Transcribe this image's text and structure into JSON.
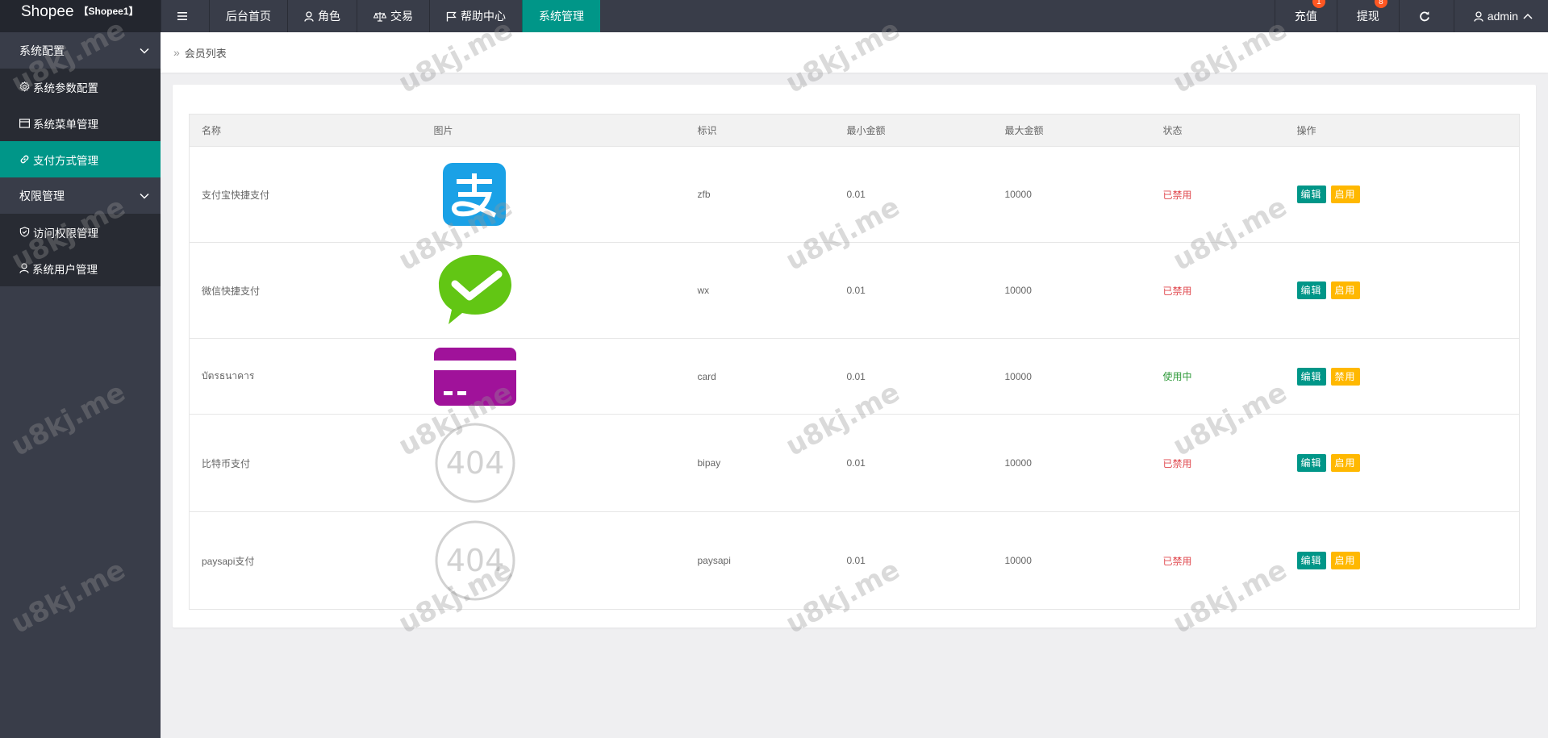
{
  "brand": {
    "name": "Shopee",
    "sub": "【Shopee1】"
  },
  "topnav": {
    "items": [
      {
        "label": "后台首页",
        "icon": "none"
      },
      {
        "label": "角色",
        "icon": "user-icon"
      },
      {
        "label": "交易",
        "icon": "scale-icon"
      },
      {
        "label": "帮助中心",
        "icon": "flag-icon"
      },
      {
        "label": "系统管理",
        "icon": "none",
        "active": true
      }
    ],
    "right": [
      {
        "label": "充值",
        "badge": "1"
      },
      {
        "label": "提现",
        "badge": "8"
      }
    ],
    "admin": "admin"
  },
  "sidebar": {
    "groups": [
      {
        "title": "系统配置",
        "items": [
          {
            "label": "系统参数配置",
            "icon": "gear-icon"
          },
          {
            "label": "系统菜单管理",
            "icon": "menu-icon"
          },
          {
            "label": "支付方式管理",
            "icon": "link-icon",
            "active": true
          }
        ]
      },
      {
        "title": "权限管理",
        "items": [
          {
            "label": "访问权限管理",
            "icon": "shield-icon"
          },
          {
            "label": "系统用户管理",
            "icon": "user-icon"
          }
        ]
      }
    ]
  },
  "breadcrumb": {
    "label": "会员列表"
  },
  "table": {
    "headers": [
      "名称",
      "图片",
      "标识",
      "最小金额",
      "最大金额",
      "状态",
      "操作"
    ],
    "rows": [
      {
        "name": "支付宝快捷支付",
        "image": "alipay-logo",
        "code": "zfb",
        "min": "0.01",
        "max": "10000",
        "status": "已禁用",
        "edit": "编辑",
        "toggle": "启用"
      },
      {
        "name": "微信快捷支付",
        "image": "wechat-logo",
        "code": "wx",
        "min": "0.01",
        "max": "10000",
        "status": "已禁用",
        "edit": "编辑",
        "toggle": "启用"
      },
      {
        "name": "บัตรธนาคาร",
        "image": "bank-card-logo",
        "code": "card",
        "min": "0.01",
        "max": "10000",
        "status": "使用中",
        "edit": "编辑",
        "toggle": "禁用"
      },
      {
        "name": "比特币支付",
        "image": "404-placeholder",
        "code": "bipay",
        "min": "0.01",
        "max": "10000",
        "status": "已禁用",
        "edit": "编辑",
        "toggle": "启用"
      },
      {
        "name": "paysapi支付",
        "image": "404-placeholder",
        "code": "paysapi",
        "min": "0.01",
        "max": "10000",
        "status": "已禁用",
        "edit": "编辑",
        "toggle": "启用"
      }
    ],
    "placeholder_text": "404"
  },
  "watermark": "u8kj.me",
  "colors": {
    "topbar": "#393d49",
    "accent": "#009688",
    "warn": "#ffb800",
    "danger": "#e0494f",
    "success": "#2f9a3a"
  }
}
